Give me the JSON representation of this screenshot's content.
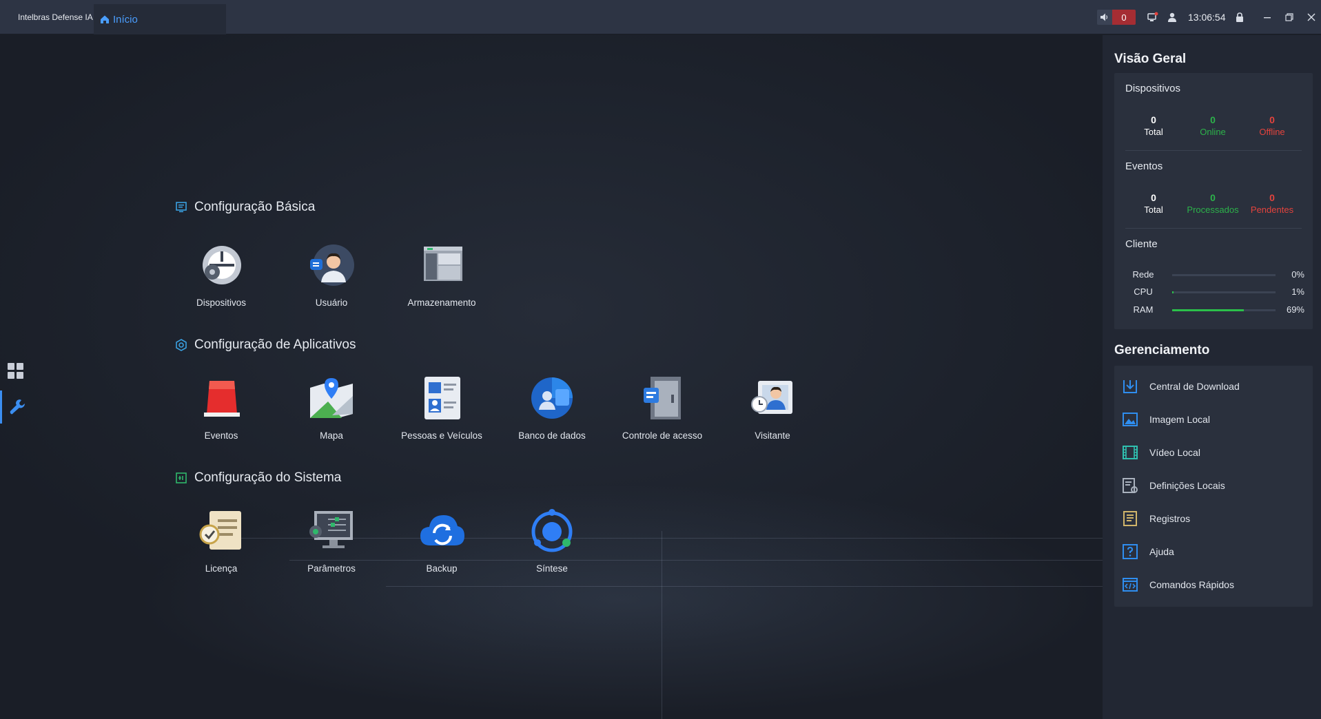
{
  "titlebar": {
    "app_name": "Intelbras Defense IA",
    "tab_label": "Início",
    "alarm_count": "0",
    "clock": "13:06:54"
  },
  "sections": {
    "basic": {
      "title": "Configuração Básica",
      "tiles": [
        {
          "label": "Dispositivos",
          "icon": "devices-icon"
        },
        {
          "label": "Usuário",
          "icon": "user-icon"
        },
        {
          "label": "Armazenamento",
          "icon": "storage-icon"
        }
      ]
    },
    "apps": {
      "title": "Configuração de Aplicativos",
      "tiles": [
        {
          "label": "Eventos",
          "icon": "alarm-light-icon"
        },
        {
          "label": "Mapa",
          "icon": "map-icon"
        },
        {
          "label": "Pessoas e Veículos",
          "icon": "id-card-icon"
        },
        {
          "label": "Banco de dados",
          "icon": "database-icon"
        },
        {
          "label": "Controle de acesso",
          "icon": "door-icon"
        },
        {
          "label": "Visitante",
          "icon": "visitor-icon"
        }
      ]
    },
    "system": {
      "title": "Configuração do Sistema",
      "tiles": [
        {
          "label": "Licença",
          "icon": "license-icon"
        },
        {
          "label": "Parâmetros",
          "icon": "parameters-icon"
        },
        {
          "label": "Backup",
          "icon": "cloud-backup-icon"
        },
        {
          "label": "Síntese",
          "icon": "synthesis-icon"
        }
      ]
    }
  },
  "overview": {
    "heading": "Visão Geral",
    "devices": {
      "title": "Dispositivos",
      "total": "0",
      "total_label": "Total",
      "online": "0",
      "online_label": "Online",
      "offline": "0",
      "offline_label": "Offline"
    },
    "events": {
      "title": "Eventos",
      "total": "0",
      "total_label": "Total",
      "processed": "0",
      "processed_label": "Processados",
      "pending": "0",
      "pending_label": "Pendentes"
    },
    "client": {
      "title": "Cliente",
      "meters": [
        {
          "label": "Rede",
          "percent": 0,
          "text": "0%"
        },
        {
          "label": "CPU",
          "percent": 1,
          "text": "1%"
        },
        {
          "label": "RAM",
          "percent": 69,
          "text": "69%"
        }
      ]
    }
  },
  "management": {
    "heading": "Gerenciamento",
    "items": [
      {
        "label": "Central de Download",
        "icon": "download-icon"
      },
      {
        "label": "Imagem Local",
        "icon": "image-icon"
      },
      {
        "label": "Vídeo Local",
        "icon": "film-icon"
      },
      {
        "label": "Definições Locais",
        "icon": "local-settings-icon"
      },
      {
        "label": "Registros",
        "icon": "logs-icon"
      },
      {
        "label": "Ajuda",
        "icon": "help-icon"
      },
      {
        "label": "Comandos Rápidos",
        "icon": "shortcut-icon"
      }
    ]
  },
  "colors": {
    "accent": "#3b8ef0",
    "online": "#2cb24a",
    "offline": "#e4433d",
    "alarm": "#a52d33"
  }
}
